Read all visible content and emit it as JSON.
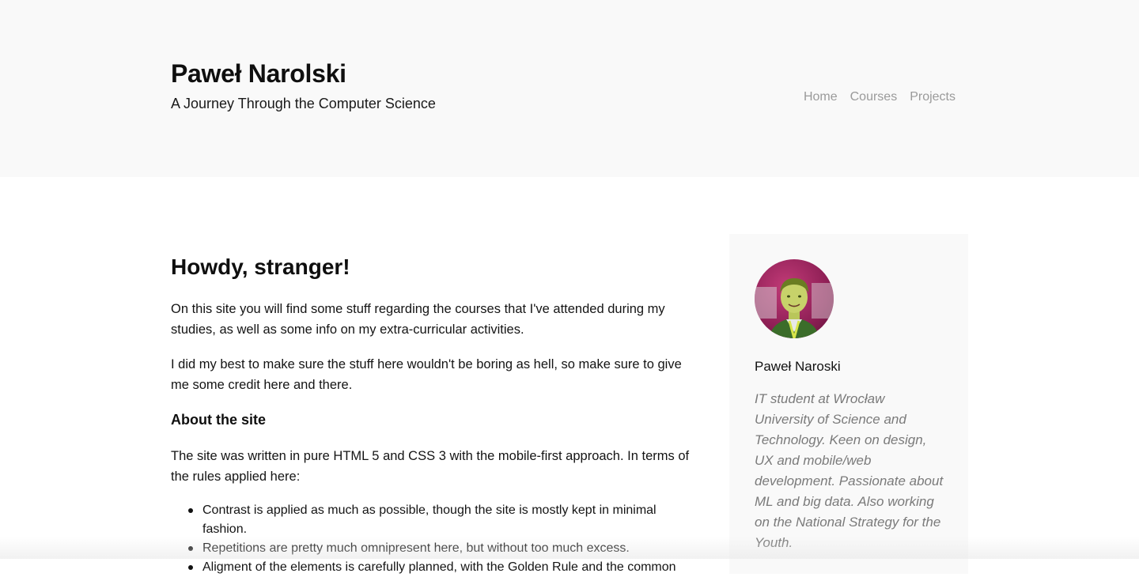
{
  "header": {
    "title": "Paweł Narolski",
    "subtitle": "A Journey Through the Computer Science",
    "nav": [
      {
        "label": "Home"
      },
      {
        "label": "Courses"
      },
      {
        "label": "Projects"
      }
    ]
  },
  "main": {
    "heading": "Howdy, stranger!",
    "paragraphs": [
      "On this site you will find some stuff regarding the courses that I've attended during my studies, as well as some info on my extra-curricular activities.",
      "I did my best to make sure the stuff here wouldn't be boring as hell, so make sure to give me some credit here and there."
    ],
    "section_heading": "About the site",
    "section_paragraph": "The site was written in pure HTML 5 and CSS 3 with the mobile-first approach. In terms of the rules applied here:",
    "list": [
      "Contrast is applied as much as possible, though the site is mostly kept in minimal fashion.",
      "Repetitions are pretty much omnipresent here, but without too much excess.",
      "Aligment of the elements is carefully planned, with the Golden Rule and the common"
    ]
  },
  "sidebar": {
    "avatar_icon": "profile-photo",
    "name": "Paweł Naroski",
    "bio": "IT student at Wrocław University of Science and Technology. Keen on design, UX and mobile/web development. Passionate about ML and big data. Also working on the National Strategy for the Youth."
  },
  "colors": {
    "header_bg": "#f9f9f9",
    "sidebar_bg": "#f9f9f9",
    "nav_text": "#9a9a9a",
    "bio_text": "#7a7a7a"
  }
}
